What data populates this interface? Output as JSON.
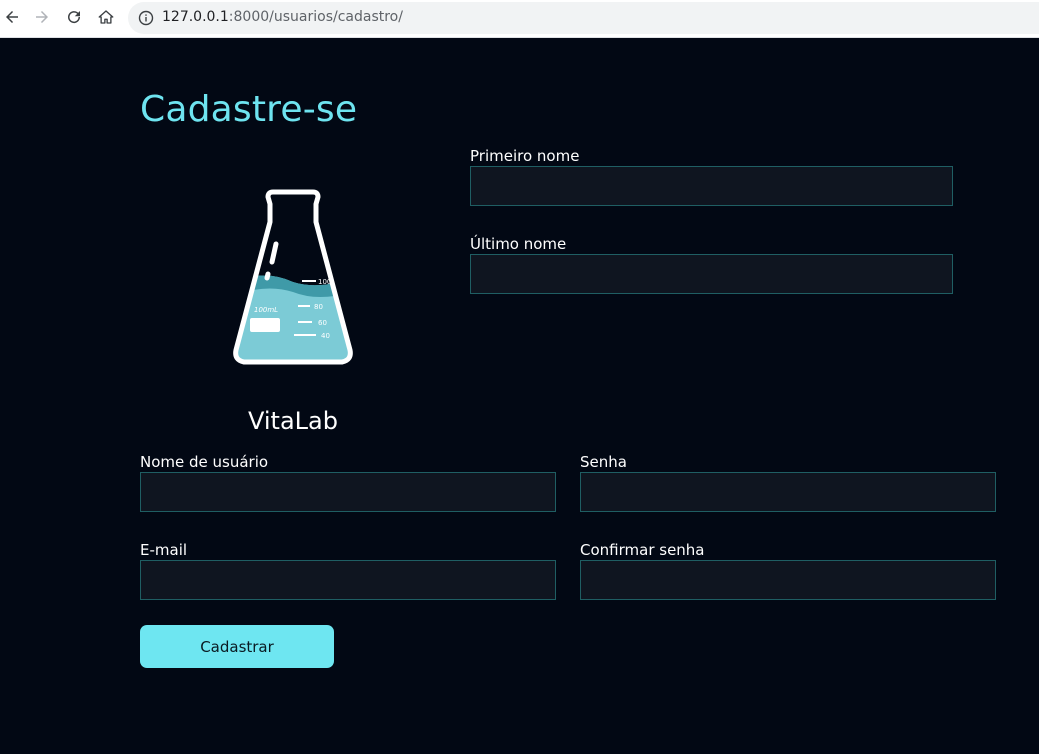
{
  "browser": {
    "url_host": "127.0.0.1",
    "url_path": ":8000/usuarios/cadastro/"
  },
  "page": {
    "title": "Cadastre-se",
    "brand": "VitaLab",
    "logo_icon": "flask-icon",
    "flask_labels": [
      "100",
      "80",
      "60",
      "40"
    ],
    "flask_volume": "100mL"
  },
  "form": {
    "first_name": {
      "label": "Primeiro nome",
      "value": ""
    },
    "last_name": {
      "label": "Último nome",
      "value": ""
    },
    "username": {
      "label": "Nome de usuário",
      "value": ""
    },
    "password": {
      "label": "Senha",
      "value": ""
    },
    "email": {
      "label": "E-mail",
      "value": ""
    },
    "confirm_password": {
      "label": "Confirmar senha",
      "value": ""
    },
    "submit_label": "Cadastrar"
  },
  "colors": {
    "background": "#020814",
    "accent": "#6ee6f1",
    "input_bg": "#0f1520",
    "input_border": "#1f5e63"
  }
}
